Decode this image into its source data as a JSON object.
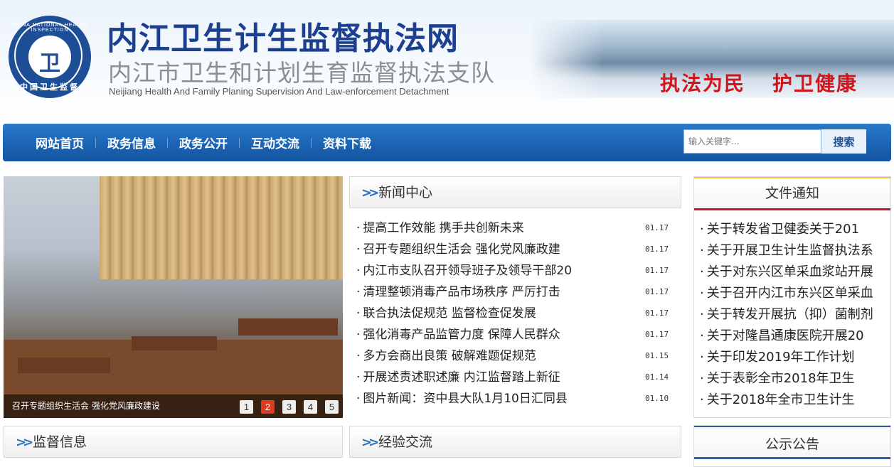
{
  "header": {
    "emblem_text_top": "CHINA NATIONAL HEALTH INSPECTION",
    "emblem_glyph": "卫",
    "emblem_text_bottom": "中国卫生监督",
    "title": "内江卫生计生监督执法网",
    "subtitle": "内江市卫生和计划生育监督执法支队",
    "english": "Neijiang Health And Family Planing Supervision And Law-enforcement Detachment",
    "slogan_1": "执法为民",
    "slogan_2": "护卫健康"
  },
  "nav": {
    "items": [
      "网站首页",
      "政务信息",
      "政务公开",
      "互动交流",
      "资料下载"
    ],
    "search_placeholder": "输入关键字...",
    "search_button": "搜索"
  },
  "slideshow": {
    "caption": "召开专题组织生活会 强化党风廉政建设",
    "pages": [
      "1",
      "2",
      "3",
      "4",
      "5"
    ],
    "active_page": 2
  },
  "news": {
    "title": "新闻中心",
    "items": [
      {
        "title": "提高工作效能 携手共创新未来",
        "date": "01.17"
      },
      {
        "title": "召开专题组织生活会 强化党风廉政建",
        "date": "01.17"
      },
      {
        "title": "内江市支队召开领导班子及领导干部20",
        "date": "01.17"
      },
      {
        "title": "清理整顿消毒产品市场秩序 严厉打击",
        "date": "01.17"
      },
      {
        "title": "联合执法促规范 监督检查促发展",
        "date": "01.17"
      },
      {
        "title": "强化消毒产品监管力度 保障人民群众",
        "date": "01.17"
      },
      {
        "title": "多方会商出良策 破解难题促规范",
        "date": "01.15"
      },
      {
        "title": "开展述责述职述廉 内江监督踏上新征",
        "date": "01.14"
      },
      {
        "title": "图片新闻：资中县大队1月10日汇同县",
        "date": "01.10"
      }
    ]
  },
  "notices": {
    "title": "文件通知",
    "items": [
      "关于转发省卫健委关于201",
      "关于开展卫生计生监督执法系",
      "关于对东兴区单采血浆站开展",
      "关于召开内江市东兴区单采血",
      "关于转发开展抗（抑）菌制剂",
      "关于对隆昌通康医院开展20",
      "关于印发2019年工作计划",
      "关于表彰全市2018年卫生",
      "关于2018年全市卫生计生"
    ]
  },
  "bottom": {
    "supervision_title": "监督信息",
    "experience_title": "经验交流",
    "announce_title": "公示公告"
  },
  "colors": {
    "nav_blue": "#1c64b4",
    "title_blue": "#1c3f8f",
    "slogan_red": "#d3141b",
    "active_dot": "#e23a1c"
  }
}
